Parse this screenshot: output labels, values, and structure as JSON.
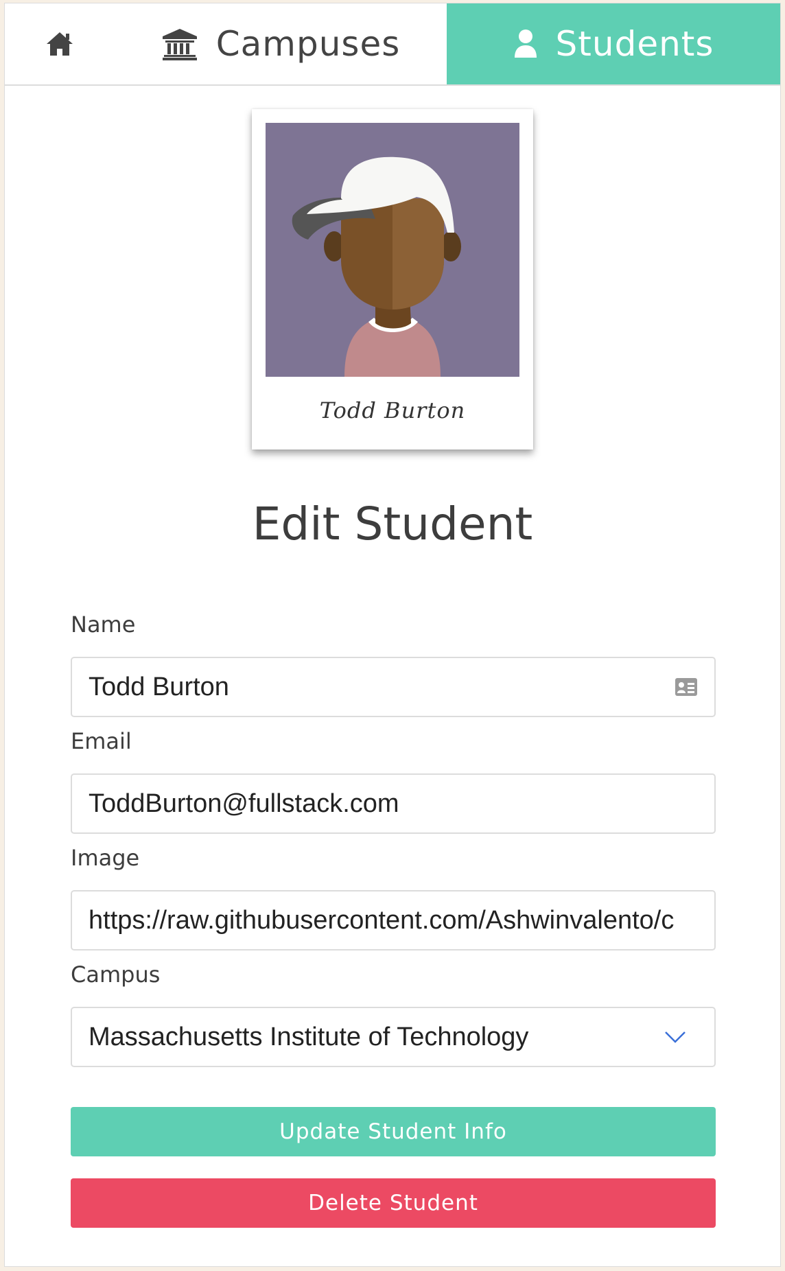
{
  "nav": {
    "home_icon": "home-icon",
    "campuses_label": "Campuses",
    "campuses_icon": "institution-icon",
    "students_label": "Students",
    "students_icon": "user-icon",
    "active_tab": "Students"
  },
  "student_card": {
    "caption": "Todd Burton",
    "photo": "student-avatar-illustration"
  },
  "page_title": "Edit Student",
  "form": {
    "name_label": "Name",
    "name_value": "Todd Burton",
    "email_label": "Email",
    "email_value": "ToddBurton@fullstack.com",
    "image_label": "Image",
    "image_value": "https://raw.githubusercontent.com/Ashwinvalento/c",
    "campus_label": "Campus",
    "campus_value": "Massachusetts Institute of Technology"
  },
  "buttons": {
    "update_label": "Update Student Info",
    "delete_label": "Delete Student"
  },
  "colors": {
    "accent": "#5ecfb3",
    "danger": "#ec4a63",
    "photo_bg": "#7e7494"
  }
}
